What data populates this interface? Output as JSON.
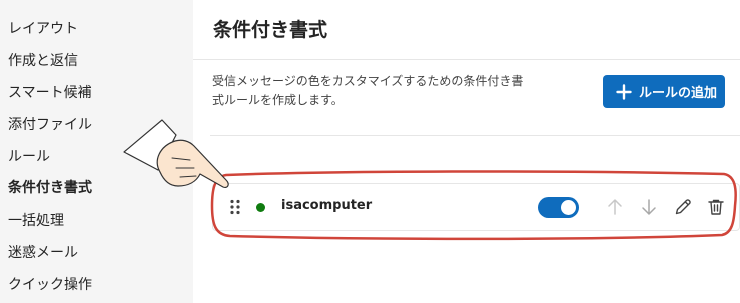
{
  "sidebar": {
    "items": [
      {
        "label": "レイアウト"
      },
      {
        "label": "作成と返信"
      },
      {
        "label": "スマート候補"
      },
      {
        "label": "添付ファイル"
      },
      {
        "label": "ルール"
      },
      {
        "label": "条件付き書式"
      },
      {
        "label": "一括処理"
      },
      {
        "label": "迷惑メール"
      },
      {
        "label": "クイック操作"
      }
    ],
    "active_item": "条件付き書式"
  },
  "main": {
    "title": "条件付き書式",
    "description_line1": "受信メッセージの色をカスタマイズするための条件付き書",
    "description_line2": "式ルールを作成します。",
    "add_rule_label": "ルールの追加",
    "rules": [
      {
        "name": "isacomputer",
        "status": "active",
        "enabled": true
      }
    ]
  },
  "icons": {
    "add": "plus-icon",
    "drag": "drag-handle-icon",
    "move_up": "arrow-up-icon",
    "move_down": "arrow-down-icon",
    "edit": "pencil-icon",
    "delete": "trash-icon"
  },
  "colors": {
    "accent": "#0f6cbd",
    "status_active": "#107c10",
    "annotation_outline": "#d0453a",
    "sidebar_bg": "#f5f5f5"
  }
}
